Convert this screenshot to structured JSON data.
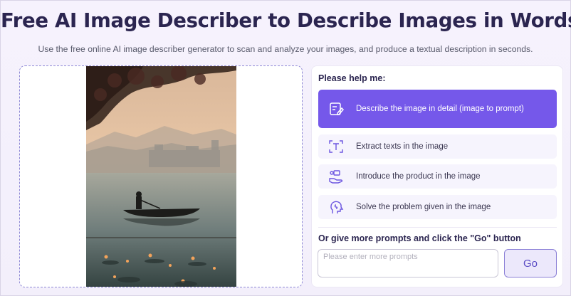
{
  "header": {
    "title": "Free AI Image Describer to Describe Images in Words",
    "subtitle": "Use the free online AI image describer generator to scan and analyze your images, and produce a textual description in seconds."
  },
  "panel": {
    "heading": "Please help me:",
    "options": [
      {
        "label": "Describe the image in detail (image to prompt)",
        "icon": "edit-document-icon",
        "selected": true
      },
      {
        "label": "Extract texts in the image",
        "icon": "text-scan-icon",
        "selected": false
      },
      {
        "label": "Introduce the product in the image",
        "icon": "product-hand-icon",
        "selected": false
      },
      {
        "label": "Solve the problem given in the image",
        "icon": "brain-head-icon",
        "selected": false
      }
    ],
    "prompt_heading": "Or give more prompts and click the \"Go\" button",
    "prompt_placeholder": "Please enter more prompts",
    "go_label": "Go"
  },
  "colors": {
    "accent": "#7558ea",
    "title": "#2b2550",
    "option_bg": "#f6f4fd"
  }
}
